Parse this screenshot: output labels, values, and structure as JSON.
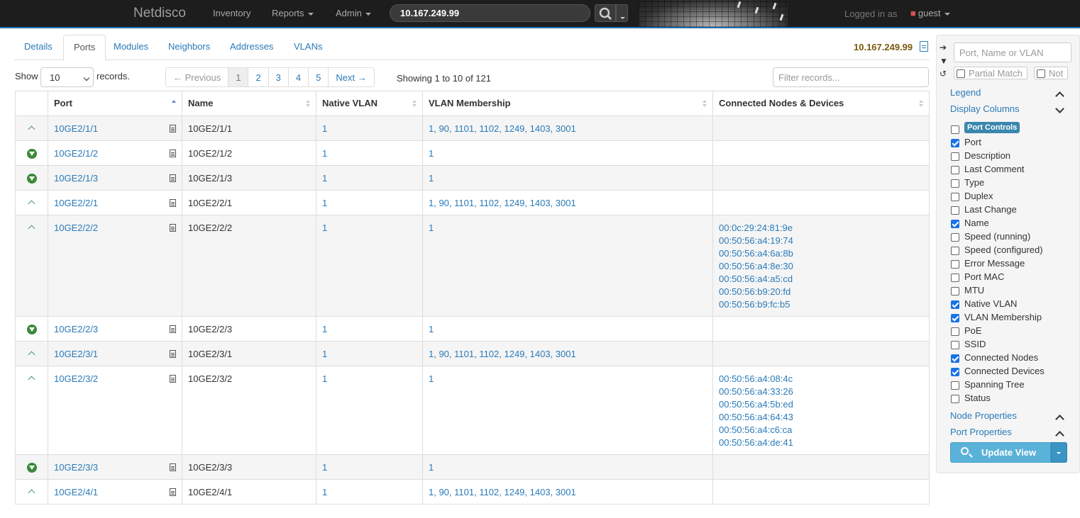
{
  "navbar": {
    "brand": "Netdisco",
    "menu": [
      {
        "label": "Inventory",
        "dropdown": false
      },
      {
        "label": "Reports",
        "dropdown": true
      },
      {
        "label": "Admin",
        "dropdown": true
      }
    ],
    "search_value": "10.167.249.99",
    "logged_in_label": "Logged in as",
    "user": "guest"
  },
  "tabs": [
    "Details",
    "Ports",
    "Modules",
    "Neighbors",
    "Addresses",
    "VLANs"
  ],
  "active_tab": "Ports",
  "device_ip": "10.167.249.99",
  "controls": {
    "show_label": "Show",
    "page_size": "10",
    "records_label": "records.",
    "pager": [
      "← Previous",
      "1",
      "2",
      "3",
      "4",
      "5",
      "Next →"
    ],
    "active_page": "1",
    "showing": "Showing 1 to 10 of 121",
    "filter_placeholder": "Filter records..."
  },
  "table": {
    "headers": [
      "",
      "Port",
      "Name",
      "Native VLAN",
      "VLAN Membership",
      "Connected Nodes & Devices"
    ],
    "rows": [
      {
        "state": "up",
        "port": "10GE2/1/1",
        "name": "10GE2/1/1",
        "native_vlan": "1",
        "vlans": "1, 90, 1101, 1102, 1249, 1403, 3001",
        "nodes": []
      },
      {
        "state": "down",
        "port": "10GE2/1/2",
        "name": "10GE2/1/2",
        "native_vlan": "1",
        "vlans": "1",
        "nodes": []
      },
      {
        "state": "down",
        "port": "10GE2/1/3",
        "name": "10GE2/1/3",
        "native_vlan": "1",
        "vlans": "1",
        "nodes": []
      },
      {
        "state": "up",
        "port": "10GE2/2/1",
        "name": "10GE2/2/1",
        "native_vlan": "1",
        "vlans": "1, 90, 1101, 1102, 1249, 1403, 3001",
        "nodes": []
      },
      {
        "state": "up",
        "port": "10GE2/2/2",
        "name": "10GE2/2/2",
        "native_vlan": "1",
        "vlans": "1",
        "nodes": [
          "00:0c:29:24:81:9e",
          "00:50:56:a4:19:74",
          "00:50:56:a4:6a:8b",
          "00:50:56:a4:8e:30",
          "00:50:56:a4:a5:cd",
          "00:50:56:b9:20:fd",
          "00:50:56:b9:fc:b5"
        ]
      },
      {
        "state": "down",
        "port": "10GE2/2/3",
        "name": "10GE2/2/3",
        "native_vlan": "1",
        "vlans": "1",
        "nodes": []
      },
      {
        "state": "up",
        "port": "10GE2/3/1",
        "name": "10GE2/3/1",
        "native_vlan": "1",
        "vlans": "1, 90, 1101, 1102, 1249, 1403, 3001",
        "nodes": []
      },
      {
        "state": "up",
        "port": "10GE2/3/2",
        "name": "10GE2/3/2",
        "native_vlan": "1",
        "vlans": "1",
        "nodes": [
          "00:50:56:a4:08:4c",
          "00:50:56:a4:33:26",
          "00:50:56:a4:5b:ed",
          "00:50:56:a4:64:43",
          "00:50:56:a4:c6:ca",
          "00:50:56:a4:de:41"
        ]
      },
      {
        "state": "down",
        "port": "10GE2/3/3",
        "name": "10GE2/3/3",
        "native_vlan": "1",
        "vlans": "1",
        "nodes": []
      },
      {
        "state": "up",
        "port": "10GE2/4/1",
        "name": "10GE2/4/1",
        "native_vlan": "1",
        "vlans": "1, 90, 1101, 1102, 1249, 1403, 3001",
        "nodes": []
      }
    ]
  },
  "sidebar": {
    "search_placeholder": "Port, Name or VLAN",
    "partial_match": "Partial Match",
    "not_label": "Not",
    "legend": "Legend",
    "display_columns": "Display Columns",
    "port_controls": "Port Controls",
    "columns": [
      {
        "label": "Port",
        "checked": true
      },
      {
        "label": "Description",
        "checked": false
      },
      {
        "label": "Last Comment",
        "checked": false
      },
      {
        "label": "Type",
        "checked": false
      },
      {
        "label": "Duplex",
        "checked": false
      },
      {
        "label": "Last Change",
        "checked": false
      },
      {
        "label": "Name",
        "checked": true
      },
      {
        "label": "Speed (running)",
        "checked": false
      },
      {
        "label": "Speed (configured)",
        "checked": false
      },
      {
        "label": "Error Message",
        "checked": false
      },
      {
        "label": "Port MAC",
        "checked": false
      },
      {
        "label": "MTU",
        "checked": false
      },
      {
        "label": "Native VLAN",
        "checked": true
      },
      {
        "label": "VLAN Membership",
        "checked": true
      },
      {
        "label": "PoE",
        "checked": false
      },
      {
        "label": "SSID",
        "checked": false
      },
      {
        "label": "Connected Nodes",
        "checked": true
      },
      {
        "label": "Connected Devices",
        "checked": true
      },
      {
        "label": "Spanning Tree",
        "checked": false
      },
      {
        "label": "Status",
        "checked": false
      }
    ],
    "node_properties": "Node Properties",
    "port_properties": "Port Properties",
    "update_view": "Update View"
  }
}
